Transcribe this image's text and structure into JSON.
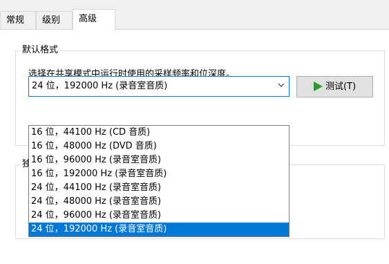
{
  "tabs": [
    {
      "label": "常规"
    },
    {
      "label": "级别"
    },
    {
      "label": "高级"
    }
  ],
  "default_format": {
    "legend": "默认格式",
    "description": "选择在共享模式中运行时使用的采样频率和位深度。",
    "selected": "24 位，192000 Hz (录音室音质)",
    "test_button": "测试(T)"
  },
  "exclusive": {
    "legend": "独"
  },
  "dropdown_options": [
    "16 位，44100 Hz (CD 音质)",
    "16 位，48000 Hz (DVD 音质)",
    "16 位，96000 Hz (录音室音质)",
    "16 位，192000 Hz (录音室音质)",
    "24 位，44100 Hz (录音室音质)",
    "24 位，48000 Hz (录音室音质)",
    "24 位，96000 Hz (录音室音质)",
    "24 位，192000 Hz (录音室音质)"
  ],
  "selected_index": 7,
  "colors": {
    "accent": "#0078d7",
    "play_icon": "#2c9a2c"
  },
  "icons": {
    "combo_arrow": "chevron-down-icon",
    "test": "play-icon"
  }
}
